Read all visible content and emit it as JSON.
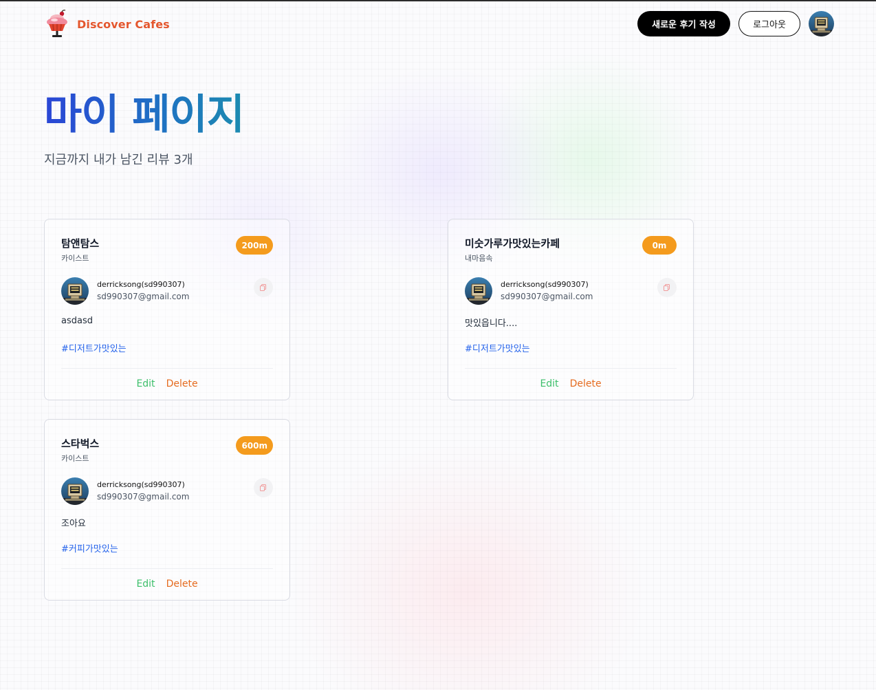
{
  "header": {
    "brand_name": "Discover Cafes",
    "new_review_label": "새로운 후기 작성",
    "logout_label": "로그아웃"
  },
  "page": {
    "title": "마이 페이지",
    "subtitle": "지금까지 내가 남긴 리뷰 3개"
  },
  "reviews": [
    {
      "cafe_name": "탐앤탐스",
      "location": "카이스트",
      "distance": "200m",
      "user_name": "derricksong(sd990307)",
      "user_email": "sd990307@gmail.com",
      "content": "asdasd",
      "tag": "#디저트가맛있는",
      "edit_label": "Edit",
      "delete_label": "Delete"
    },
    {
      "cafe_name": "미숫가루가맛있는카페",
      "location": "내마음속",
      "distance": "0m",
      "user_name": "derricksong(sd990307)",
      "user_email": "sd990307@gmail.com",
      "content": "맛있읍니다....",
      "tag": "#디저트가맛있는",
      "edit_label": "Edit",
      "delete_label": "Delete"
    },
    {
      "cafe_name": "스타벅스",
      "location": "카이스트",
      "distance": "600m",
      "user_name": "derricksong(sd990307)",
      "user_email": "sd990307@gmail.com",
      "content": "조아요",
      "tag": "#커피가맛있는",
      "edit_label": "Edit",
      "delete_label": "Delete"
    }
  ],
  "colors": {
    "brand": "#e4572e",
    "badge": "#f49b1d",
    "title_gradient_start": "#2b46d6",
    "title_gradient_end": "#1c8bb0",
    "tag": "#2563eb",
    "edit": "#3cbf6a",
    "delete": "#e56b1f"
  },
  "icons": {
    "brand": "cupcake-logo-icon",
    "avatar": "retro-computer-avatar",
    "copy": "copy-icon"
  }
}
